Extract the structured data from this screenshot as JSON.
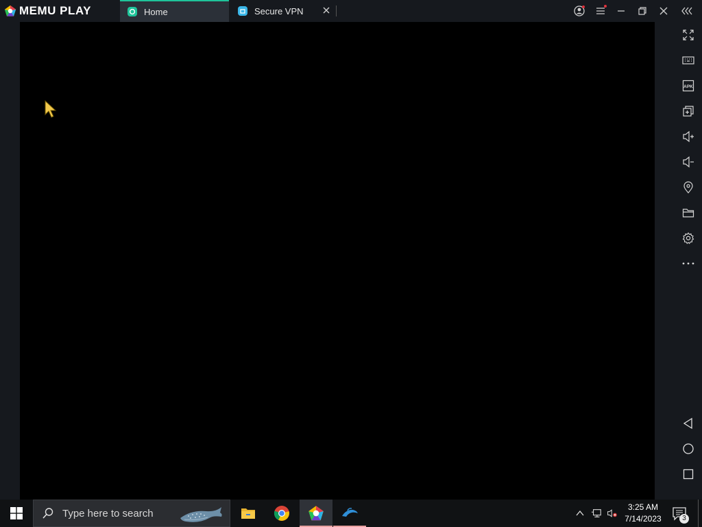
{
  "app": {
    "name": "MEMU PLAY"
  },
  "tabs": [
    {
      "label": "Home",
      "active": true
    },
    {
      "label": "Secure VPN",
      "active": false
    }
  ],
  "window_controls": [
    "account-icon",
    "menu-icon",
    "minimize-icon",
    "restore-icon",
    "close-icon",
    "collapse-sidebar-icon"
  ],
  "sidebar": {
    "tools": [
      "fullscreen-icon",
      "keyboard-mapping-icon",
      "apk-install-icon",
      "multi-instance-icon",
      "volume-up-icon",
      "volume-down-icon",
      "location-icon",
      "shared-folder-icon",
      "settings-icon",
      "more-icon"
    ],
    "nav": [
      "back-icon",
      "home-icon",
      "recent-apps-icon"
    ]
  },
  "taskbar": {
    "search_placeholder": "Type here to search",
    "apps": [
      "file-explorer-icon",
      "chrome-icon",
      "memu-icon",
      "dolphin-icon"
    ],
    "clock_time": "3:25 AM",
    "clock_date": "7/14/2023",
    "notification_count": "3"
  },
  "colors": {
    "accent": "#1fc49a",
    "frame": "#16191e",
    "screen": "#000000",
    "taskbar": "#101214"
  }
}
